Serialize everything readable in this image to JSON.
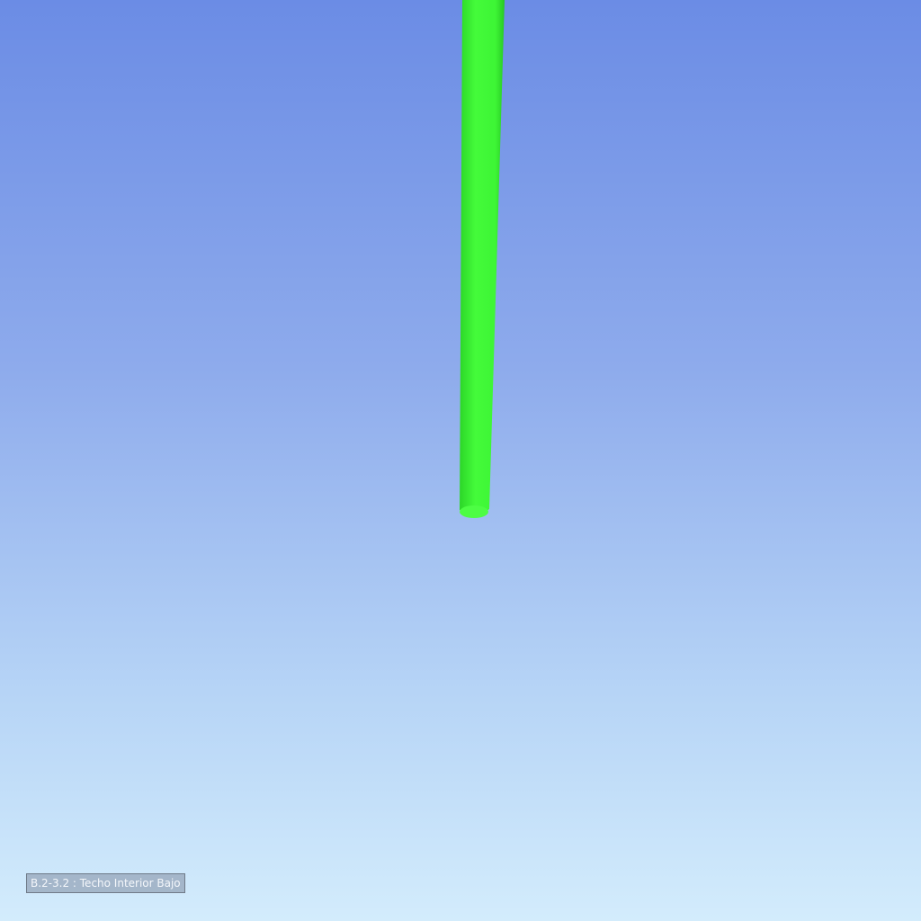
{
  "viewer": {
    "background_top_color": "#6b8ce5",
    "background_bottom_color": "#d3ecfc",
    "object_color": "#3df535",
    "status_label": "B.2-3.2 : Techo Interior Bajo"
  }
}
